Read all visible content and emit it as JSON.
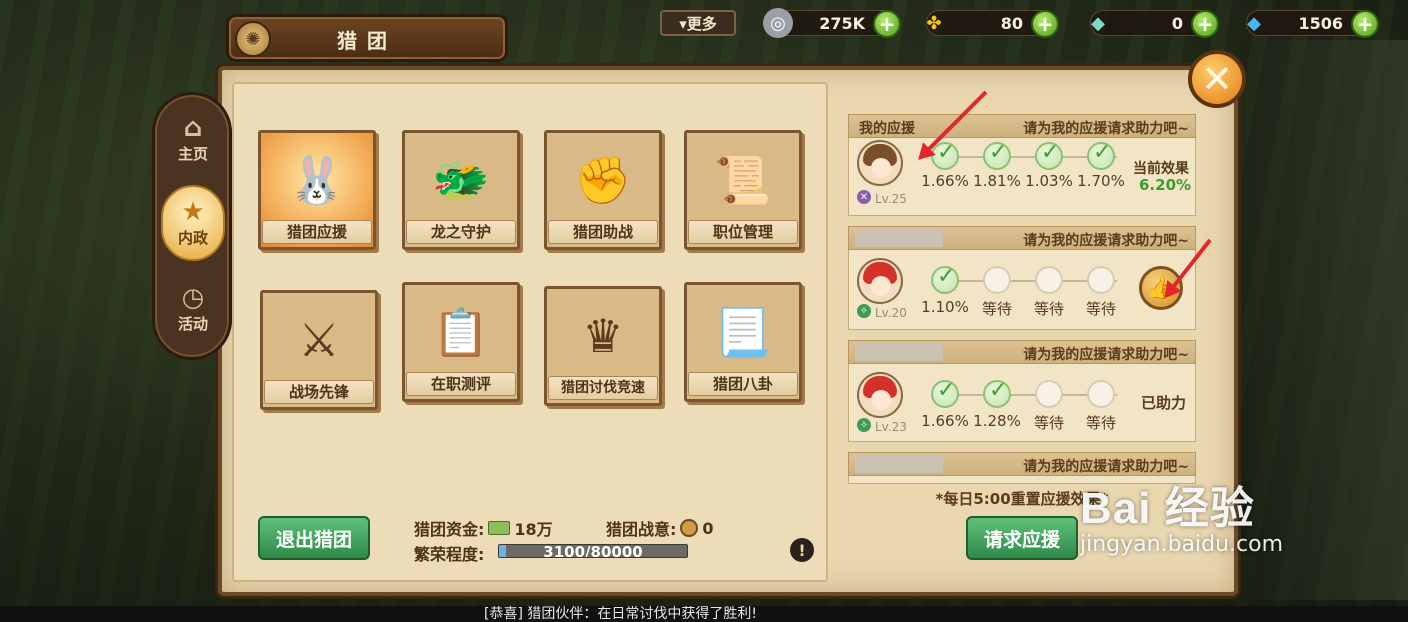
{
  "top_bar": {
    "more_label": "▾更多",
    "resources": [
      {
        "name": "coin",
        "value": "275K",
        "icon": "silver-coin-icon"
      },
      {
        "name": "clover",
        "value": "80",
        "icon": "clover-icon"
      },
      {
        "name": "prism",
        "value": "0",
        "icon": "rainbow-crystal-icon"
      },
      {
        "name": "diamond",
        "value": "1506",
        "icon": "blue-diamond-icon"
      }
    ]
  },
  "title": "猎团",
  "side_tabs": [
    {
      "label": "主页",
      "icon": "home-icon",
      "active": false
    },
    {
      "label": "内政",
      "icon": "badge-icon",
      "active": true
    },
    {
      "label": "活动",
      "icon": "stopwatch-icon",
      "active": false
    }
  ],
  "cards": [
    {
      "label": "猎团应援",
      "icon": "rabbit-mascot-icon"
    },
    {
      "label": "龙之守护",
      "icon": "dragon-icon"
    },
    {
      "label": "猎团助战",
      "icon": "fist-icon"
    },
    {
      "label": "职位管理",
      "icon": "scroll-magnifier-icon"
    },
    {
      "label": "战场先锋",
      "icon": "hero-sword-icon"
    },
    {
      "label": "在职测评",
      "icon": "clipboard-quill-icon"
    },
    {
      "label": "猎团讨伐竞速",
      "icon": "crown-shield-icon"
    },
    {
      "label": "猎团八卦",
      "icon": "gossip-scroll-icon"
    }
  ],
  "bottom_left": {
    "exit_label": "退出猎团",
    "funds_label": "猎团资金:",
    "funds_value": "18万",
    "morale_label": "猎团战意:",
    "morale_value": "0",
    "prosperity_label": "繁荣程度:",
    "prosperity_text": "3100/80000",
    "prosperity_fraction": 0.03875
  },
  "support": {
    "rows": [
      {
        "title": "我的应援",
        "hint": "请为我的应援请求助力吧~",
        "avatar": "brown",
        "level": "Lv.25",
        "slots": [
          {
            "done": true,
            "value": "1.66%"
          },
          {
            "done": true,
            "value": "1.81%"
          },
          {
            "done": true,
            "value": "1.03%"
          },
          {
            "done": true,
            "value": "1.70%"
          }
        ],
        "effect_label": "当前效果",
        "effect_value": "6.20%"
      },
      {
        "title": "",
        "hint": "请为我的应援请求助力吧~",
        "avatar": "red",
        "level": "Lv.20",
        "slots": [
          {
            "done": true,
            "value": "1.10%"
          },
          {
            "done": false,
            "value": "等待"
          },
          {
            "done": false,
            "value": "等待"
          },
          {
            "done": false,
            "value": "等待"
          }
        ],
        "action": "thumbs-up"
      },
      {
        "title": "",
        "hint": "请为我的应援请求助力吧~",
        "avatar": "red",
        "level": "Lv.23",
        "slots": [
          {
            "done": true,
            "value": "1.66%"
          },
          {
            "done": true,
            "value": "1.28%"
          },
          {
            "done": false,
            "value": "等待"
          },
          {
            "done": false,
            "value": "等待"
          }
        ],
        "status": "已助力"
      },
      {
        "title": "",
        "hint": "请为我的应援请求助力吧~"
      }
    ],
    "reset_note": "*每日5:00重置应援效果*",
    "request_label": "请求应援"
  },
  "watermark": {
    "logo": "Bai 经验",
    "sub": "jingyan.baidu.com"
  },
  "ticker": "[恭喜]  猎团伙伴：在日常讨伐中获得了胜利!"
}
